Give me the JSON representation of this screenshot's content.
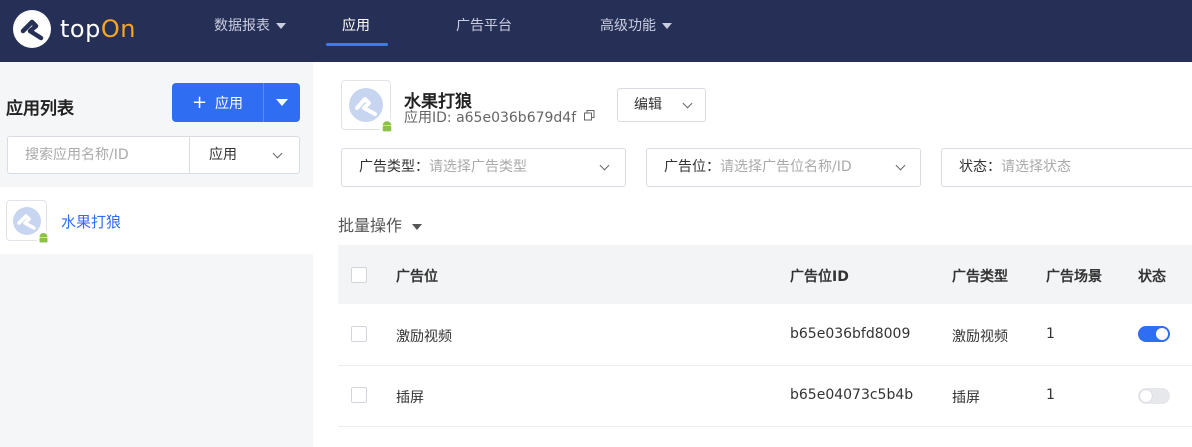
{
  "brand": {
    "logo_text_a": "top",
    "logo_text_b": "On",
    "accent": "#f6a623",
    "nav_bg": "#262f55",
    "primary": "#2f6df2"
  },
  "nav": {
    "items": [
      {
        "label": "数据报表",
        "has_caret": true
      },
      {
        "label": "应用",
        "active": true
      },
      {
        "label": "广告平台"
      },
      {
        "label": "高级功能",
        "has_caret": true
      }
    ]
  },
  "sidebar": {
    "title": "应用列表",
    "add_button": {
      "icon": "plus-icon",
      "label": "应用"
    },
    "search_placeholder": "搜索应用名称/ID",
    "filter_value": "应用",
    "apps": [
      {
        "name": "水果打狼",
        "platform": "android-icon"
      }
    ]
  },
  "app_detail": {
    "name": "水果打狼",
    "id_label": "应用ID: a65e036b679d4f",
    "edit_label": "编辑"
  },
  "filters": [
    {
      "label": "广告类型：",
      "placeholder": "请选择广告类型"
    },
    {
      "label": "广告位：",
      "placeholder": "请选择广告位名称/ID"
    },
    {
      "label": "状态：",
      "placeholder": "请选择状态"
    }
  ],
  "batch_label": "批量操作",
  "table": {
    "headers": [
      "广告位",
      "广告位ID",
      "广告类型",
      "广告场景",
      "状态"
    ],
    "rows": [
      {
        "name": "激励视频",
        "id": "b65e036bfd8009",
        "type": "激励视频",
        "scenes": "1",
        "enabled": true
      },
      {
        "name": "插屏",
        "id": "b65e04073c5b4b",
        "type": "插屏",
        "scenes": "1",
        "enabled": false
      }
    ]
  }
}
